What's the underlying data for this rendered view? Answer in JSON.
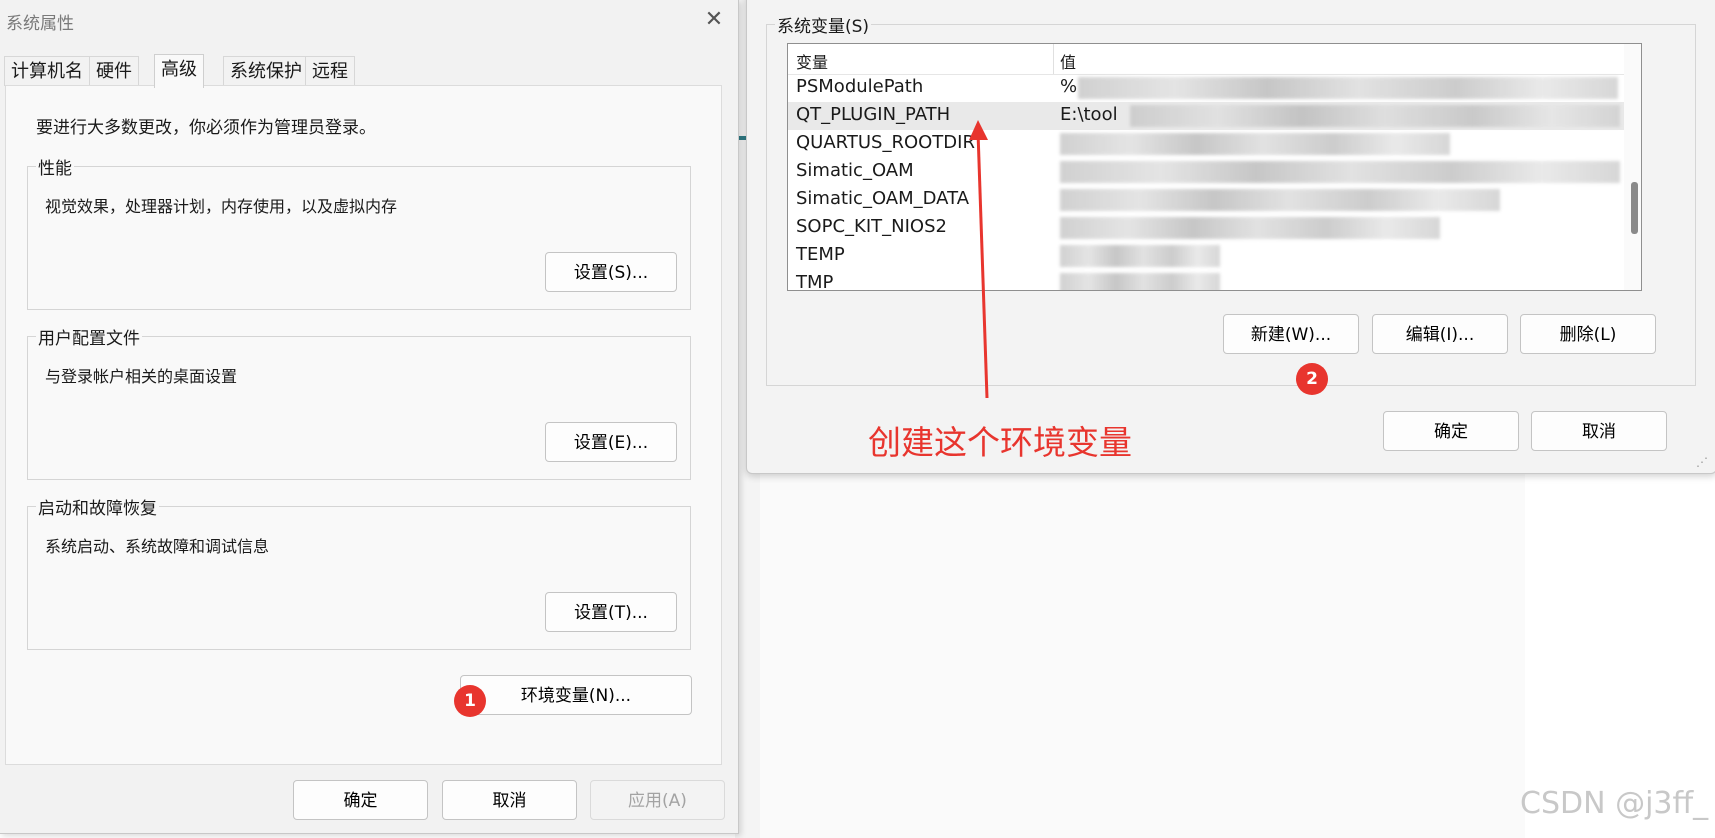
{
  "system_properties": {
    "title": "系统属性",
    "close_icon": "close-icon",
    "tabs": [
      {
        "label": "计算机名",
        "active": false
      },
      {
        "label": "硬件",
        "active": false
      },
      {
        "label": "高级",
        "active": true
      },
      {
        "label": "系统保护",
        "active": false
      },
      {
        "label": "远程",
        "active": false
      }
    ],
    "admin_note": "要进行大多数更改，你必须作为管理员登录。",
    "groups": [
      {
        "legend": "性能",
        "description": "视觉效果，处理器计划，内存使用，以及虚拟内存",
        "button": "设置(S)..."
      },
      {
        "legend": "用户配置文件",
        "description": "与登录帐户相关的桌面设置",
        "button": "设置(E)..."
      },
      {
        "legend": "启动和故障恢复",
        "description": "系统启动、系统故障和调试信息",
        "button": "设置(T)..."
      }
    ],
    "env_button": "环境变量(N)...",
    "buttons": {
      "ok": "确定",
      "cancel": "取消",
      "apply": "应用(A)"
    }
  },
  "environment_variables": {
    "system_group_legend": "系统变量(S)",
    "columns": {
      "name": "变量",
      "value": "值"
    },
    "rows": [
      {
        "name": "PSModulePath",
        "value": "%",
        "selected": false
      },
      {
        "name": "QT_PLUGIN_PATH",
        "value": "E:\\tool",
        "selected": true
      },
      {
        "name": "QUARTUS_ROOTDIR",
        "value": "",
        "selected": false
      },
      {
        "name": "Simatic_OAM",
        "value": "",
        "selected": false
      },
      {
        "name": "Simatic_OAM_DATA",
        "value": "",
        "selected": false
      },
      {
        "name": "SOPC_KIT_NIOS2",
        "value": "",
        "selected": false
      },
      {
        "name": "TEMP",
        "value": "",
        "selected": false
      },
      {
        "name": "TMP",
        "value": "",
        "selected": false
      }
    ],
    "buttons": {
      "new": "新建(W)...",
      "edit": "编辑(I)...",
      "delete": "删除(L)",
      "ok": "确定",
      "cancel": "取消"
    }
  },
  "annotations": {
    "badge1": "1",
    "badge2": "2",
    "caption": "创建这个环境变量",
    "color": "#e8352e"
  },
  "watermark": "CSDN @j3ff_"
}
